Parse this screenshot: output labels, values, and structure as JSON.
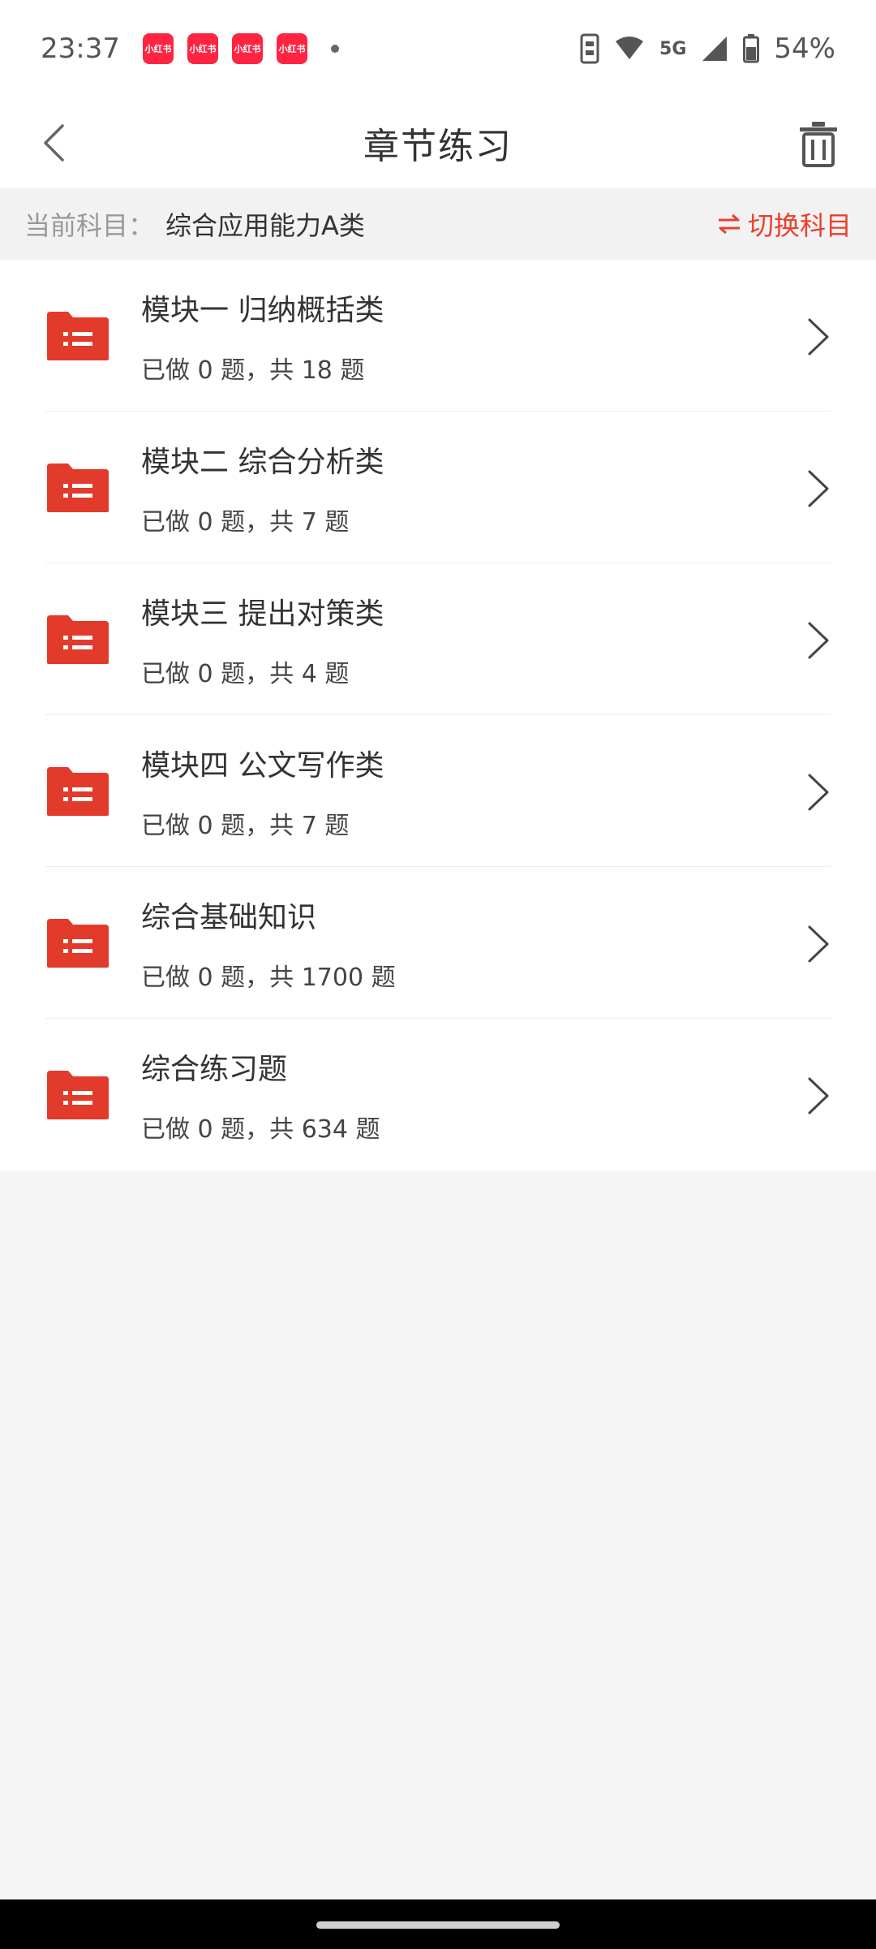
{
  "status_bar": {
    "time": "23:37",
    "notification_label": "小红书",
    "network": "5G",
    "battery": "54%"
  },
  "header": {
    "title": "章节练习"
  },
  "subject_bar": {
    "prefix": "当前科目：",
    "subject": "综合应用能力A类",
    "switch_label": "切换科目"
  },
  "chapters": [
    {
      "title": "模块一 归纳概括类",
      "progress": "已做 0 题，共 18 题"
    },
    {
      "title": "模块二 综合分析类",
      "progress": "已做 0 题，共 7 题"
    },
    {
      "title": "模块三 提出对策类",
      "progress": "已做 0 题，共 4 题"
    },
    {
      "title": "模块四 公文写作类",
      "progress": "已做 0 题，共 7 题"
    },
    {
      "title": "综合基础知识",
      "progress": "已做 0 题，共 1700 题"
    },
    {
      "title": "综合练习题",
      "progress": "已做 0 题，共 634 题"
    }
  ],
  "colors": {
    "accent": "#e8402e",
    "folder": "#e23a2b"
  },
  "icons": {
    "back": "chevron-left-icon",
    "trash": "trash-icon",
    "switch": "swap-arrows-icon",
    "folder": "folder-list-icon",
    "row_arrow": "chevron-right-icon"
  }
}
